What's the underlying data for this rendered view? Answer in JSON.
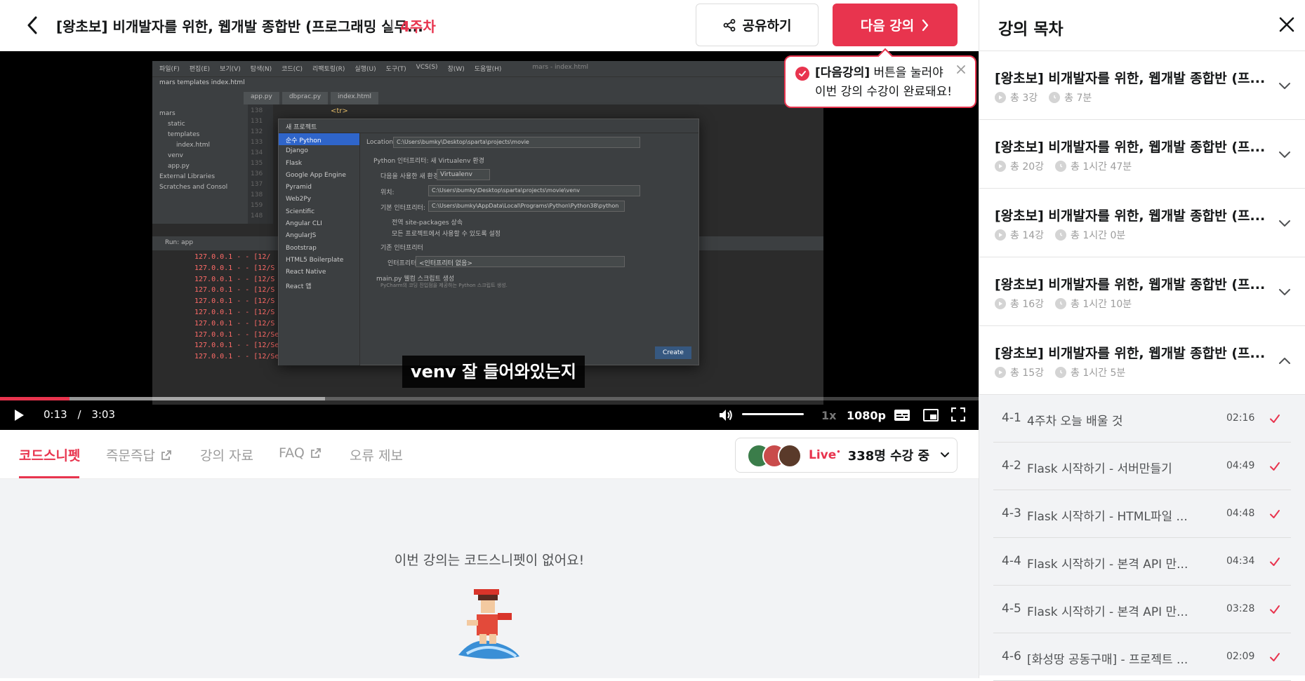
{
  "header": {
    "course_title": "[왕초보] 비개발자를 위한, 웹개발 종합반 (프로그래밍 실무...",
    "week": "4주차",
    "share_label": "공유하기",
    "next_label": "다음 강의"
  },
  "tooltip": {
    "bold": "[다음강의]",
    "line1_rest": " 버튼을 눌러야",
    "line2": "이번 강의 수강이 완료돼요!"
  },
  "player": {
    "subtitle": "venv 잘 들어와있는지",
    "current_time": "0:13",
    "separator": "/",
    "duration": "3:03",
    "progress_fraction": 0.071,
    "speed": "1x",
    "quality": "1080p"
  },
  "ide": {
    "menu": [
      "파일(F)",
      "편집(E)",
      "보기(V)",
      "탐색(N)",
      "코드(C)",
      "리팩토링(R)",
      "실행(U)",
      "도구(T)",
      "VCS(S)",
      "창(W)",
      "도움말(H)"
    ],
    "title": "mars - index.html",
    "path": "mars  templates  index.html",
    "tabs": [
      "app.py",
      "dbprac.py",
      "index.html"
    ],
    "tree": [
      "mars",
      "static",
      "templates",
      "index.html",
      "venv",
      "app.py",
      "External Libraries",
      "Scratches and Consol"
    ],
    "lines": [
      "138",
      "131",
      "132",
      "133",
      "134",
      "135",
      "136",
      "137",
      "138",
      "159",
      "148"
    ],
    "dialog_title": "새 프로젝트",
    "project_types": [
      "순수 Python",
      "Django",
      "Flask",
      "Google App Engine",
      "Pyramid",
      "Web2Py",
      "Scientific",
      "Angular CLI",
      "AngularJS",
      "Bootstrap",
      "HTML5 Boilerplate",
      "React Native",
      "React 앱"
    ],
    "location_label": "Location:",
    "location_value": "C:\\Users\\bumky\\Desktop\\sparta\\projects\\movie",
    "interpreter_section": "Python 인터프리터: 새 Virtualenv 환경",
    "new_env_label": "다음을 사용한 새 환경",
    "env_tool": "Virtualenv",
    "location2_label": "위치:",
    "location2_value": "C:\\Users\\bumky\\Desktop\\sparta\\projects\\movie\\venv",
    "base_label": "기본 인터프리터:",
    "base_value": "C:\\Users\\bumky\\AppData\\Local\\Programs\\Python\\Python38\\python",
    "inherit_label": "전역 site-packages 상속",
    "share_label": "모든 프로젝트에서 사용할 수 있도록 설정",
    "existing_label": "기존 인터프리터",
    "interp_label": "인터프리터:",
    "interp_value": "<인터프리터 없음>",
    "welcome_label": "main.py 웰컴 스크립트 생성",
    "welcome_hint": "PyCharm의 코딩 진입점을 제공하는 Python 스크립트 생성.",
    "create_label": "Create",
    "run_label": "Run:",
    "run_tab": "app",
    "logs": [
      "127.0.0.1 - - [12/",
      "127.0.0.1 - - [12/S",
      "127.0.0.1 - - [12/S",
      "127.0.0.1 - - [12/S",
      "127.0.0.1 - - [12/S",
      "127.0.0.1 - - [12/S",
      "127.0.0.1 - - [12/S",
      "127.0.0.1 - - [12/Sep/2021 13:24:02] \"POST /mars",
      "127.0.0.1 - - [12/Sep/2021 13:24:02] \"GET / HTTP",
      "127.0.0.1 - - [12/Sep/2021 13:24:04] \"GET /mars HTTP/1.1\" 200 -"
    ]
  },
  "tabs": [
    {
      "label": "코드스니펫",
      "external": false
    },
    {
      "label": "즉문즉답",
      "external": true
    },
    {
      "label": "강의 자료",
      "external": false
    },
    {
      "label": "FAQ",
      "external": true
    },
    {
      "label": "오류 제보",
      "external": false
    }
  ],
  "live": {
    "label": "Live",
    "count": "338명 수강 중"
  },
  "content": {
    "empty_message": "이번 강의는 코드스니펫이 없어요!"
  },
  "sidebar": {
    "title": "강의 목차",
    "weeks": [
      {
        "title": "[왕초보] 비개발자를 위한, 웹개발 종합반 (프...",
        "count": "총 3강",
        "time": "총 7분",
        "expanded": false
      },
      {
        "title": "[왕초보] 비개발자를 위한, 웹개발 종합반 (프...",
        "count": "총 20강",
        "time": "총 1시간 47분",
        "expanded": false
      },
      {
        "title": "[왕초보] 비개발자를 위한, 웹개발 종합반 (프...",
        "count": "총 14강",
        "time": "총 1시간 0분",
        "expanded": false
      },
      {
        "title": "[왕초보] 비개발자를 위한, 웹개발 종합반 (프...",
        "count": "총 16강",
        "time": "총 1시간 10분",
        "expanded": false
      },
      {
        "title": "[왕초보] 비개발자를 위한, 웹개발 종합반 (프...",
        "count": "총 15강",
        "time": "총 1시간 5분",
        "expanded": true
      }
    ],
    "lessons": [
      {
        "no": "4-1",
        "title": "4주차 오늘 배울 것",
        "duration": "02:16",
        "done": true
      },
      {
        "no": "4-2",
        "title": "Flask 시작하기 - 서버만들기",
        "duration": "04:49",
        "done": true
      },
      {
        "no": "4-3",
        "title": "Flask 시작하기 - HTML파일 ...",
        "duration": "04:48",
        "done": true
      },
      {
        "no": "4-4",
        "title": "Flask 시작하기 - 본격 API 만...",
        "duration": "04:34",
        "done": true
      },
      {
        "no": "4-5",
        "title": "Flask 시작하기 - 본격 API 만...",
        "duration": "03:28",
        "done": true
      },
      {
        "no": "4-6",
        "title": "[화성땅 공동구매] - 프로젝트 ...",
        "duration": "02:09",
        "done": true
      }
    ]
  },
  "colors": {
    "accent": "#e8344e",
    "text": "#141617",
    "muted": "#9c9c9c",
    "panel_bg": "#f2f3f5"
  }
}
